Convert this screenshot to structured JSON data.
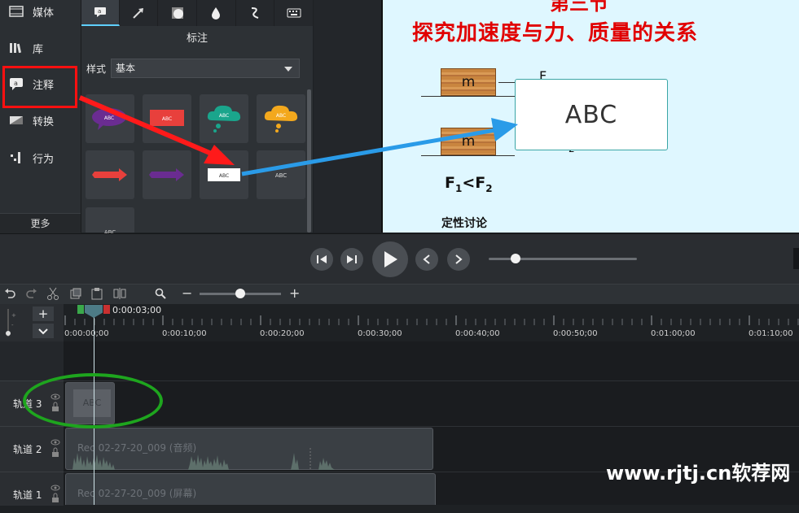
{
  "sidebar": {
    "items": [
      {
        "label": "媒体",
        "icon": "film-icon"
      },
      {
        "label": "库",
        "icon": "library-icon"
      },
      {
        "label": "注释",
        "icon": "annotation-icon"
      },
      {
        "label": "转换",
        "icon": "transition-icon"
      },
      {
        "label": "行为",
        "icon": "behavior-icon"
      }
    ],
    "more_label": "更多"
  },
  "panel": {
    "tools": [
      "callout-icon",
      "arrow-icon",
      "shape-icon",
      "blur-icon",
      "sketch-icon",
      "keystroke-icon"
    ],
    "title": "标注",
    "style_label": "样式",
    "style_value": "基本",
    "thumbs": [
      "ABC",
      "ABC",
      "ABC",
      "ABC",
      "",
      "",
      "ABC",
      "ABC",
      "ABC"
    ]
  },
  "preview": {
    "slide_title_top": "第三节",
    "slide_title": "探究加速度与力、质量的关系",
    "block_label": "m",
    "callout_text": "ABC",
    "formula_main": "F",
    "formula_sub1": "1",
    "formula_op": "<F",
    "formula_sub2": "2",
    "force_label": "F",
    "force_sub": "2",
    "discussion": "定性讨论"
  },
  "timeline": {
    "current_time": "0:00:03;00",
    "ticks": [
      "0:00:00;00",
      "0:00:10;00",
      "0:00:20;00",
      "0:00:30;00",
      "0:00:40;00",
      "0:00:50;00",
      "0:01:00;00",
      "0:01:10;00"
    ],
    "tracks": [
      {
        "name": "轨道 3",
        "clip": "ABC"
      },
      {
        "name": "轨道 2",
        "clip": "Rec 02-27-20_009 (音频)"
      },
      {
        "name": "轨道 1",
        "clip": "Rec 02-27-20_009 (屏幕)"
      }
    ]
  },
  "watermark": "www.rjtj.cn软荐网",
  "colors": {
    "accent": "#5fd0ff",
    "highlight_red": "#ff1010",
    "highlight_green": "#1ea51e",
    "title_red": "#e10000"
  }
}
